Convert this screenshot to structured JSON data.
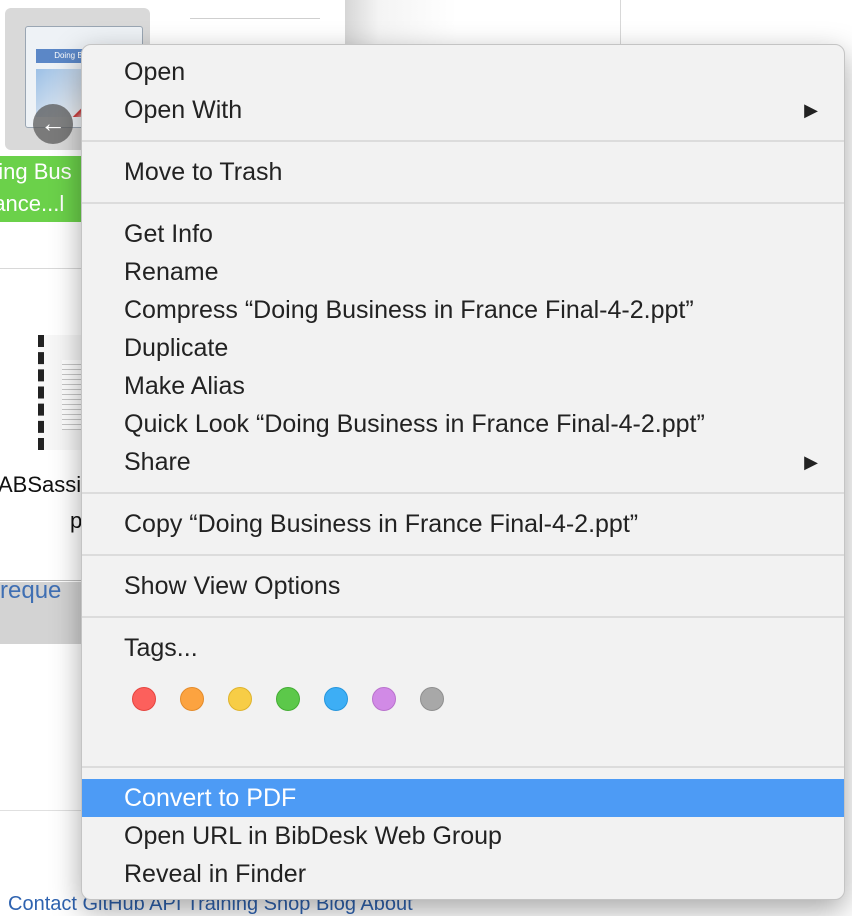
{
  "background": {
    "selected_file": {
      "thumb_banner": "Doing Business",
      "label_line1": "oing Bus",
      "label_line2": "rance...l"
    },
    "second_file_label_line1": "ABSassi",
    "second_file_label_line2": "p",
    "link_text": "reque",
    "footer_text": "Contact GitHub   API   Training   Shop   Blog   About"
  },
  "menu": {
    "sections": [
      [
        {
          "label": "Open"
        },
        {
          "label": "Open With",
          "submenu": true
        }
      ],
      [
        {
          "label": "Move to Trash"
        }
      ],
      [
        {
          "label": "Get Info"
        },
        {
          "label": "Rename"
        },
        {
          "label": "Compress “Doing Business in France Final-4-2.ppt”"
        },
        {
          "label": "Duplicate"
        },
        {
          "label": "Make Alias"
        },
        {
          "label": "Quick Look “Doing Business in France Final-4-2.ppt”"
        },
        {
          "label": "Share",
          "submenu": true
        }
      ],
      [
        {
          "label": "Copy “Doing Business in France Final-4-2.ppt”"
        }
      ],
      [
        {
          "label": "Show View Options"
        }
      ],
      [
        {
          "label": "Tags..."
        }
      ],
      [
        {
          "label": "Convert to PDF",
          "highlighted": true
        },
        {
          "label": "Open URL in BibDesk Web Group"
        },
        {
          "label": "Reveal in Finder"
        }
      ]
    ],
    "submenu_arrow": "▶",
    "tags": [
      {
        "name": "red",
        "fill": "#fc605c",
        "stroke": "#e5443f"
      },
      {
        "name": "orange",
        "fill": "#fca340",
        "stroke": "#e48b2a"
      },
      {
        "name": "yellow",
        "fill": "#f7cd46",
        "stroke": "#dfb32c"
      },
      {
        "name": "green",
        "fill": "#5cc84a",
        "stroke": "#44ad34"
      },
      {
        "name": "blue",
        "fill": "#3daef5",
        "stroke": "#2596dd"
      },
      {
        "name": "purple",
        "fill": "#d18ae6",
        "stroke": "#b972cd"
      },
      {
        "name": "gray",
        "fill": "#a8a8a8",
        "stroke": "#8f8f8f"
      }
    ]
  },
  "colors": {
    "highlight": "#4d9bf5",
    "selection_label": "#6bd14a"
  }
}
